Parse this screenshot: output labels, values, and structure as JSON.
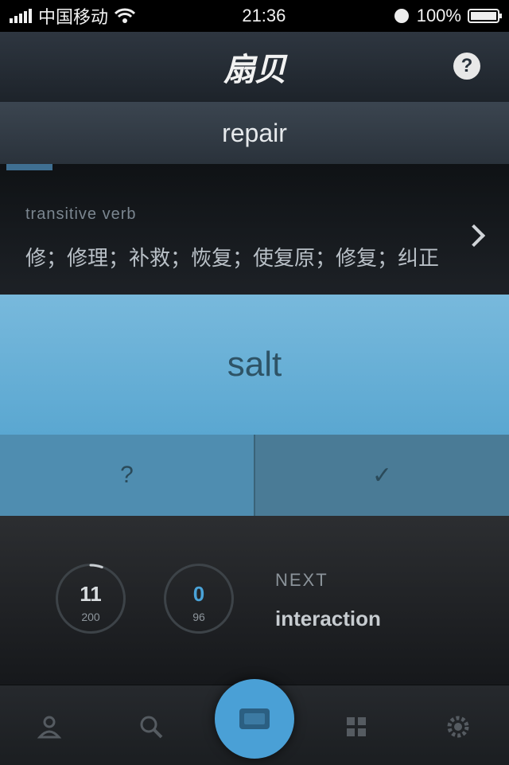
{
  "status_bar": {
    "carrier": "中国移动",
    "time": "21:36",
    "battery": "100%"
  },
  "header": {
    "logo": "扇贝"
  },
  "word_bar": {
    "word": "repair"
  },
  "definition": {
    "part_of_speech": "transitive verb",
    "text": "修；修理；补救；恢复；使复原；修复；纠正"
  },
  "card": {
    "word": "salt"
  },
  "answers": {
    "unknown_label": "?",
    "known_label": "✓"
  },
  "progress": {
    "ring1": {
      "count": "11",
      "total": "200",
      "fraction": 0.055
    },
    "ring2": {
      "count": "0",
      "total": "96",
      "fraction": 0
    },
    "next_label": "NEXT",
    "next_word": "interaction"
  },
  "tabbar": {
    "items": [
      {
        "icon": "user-icon"
      },
      {
        "icon": "search-icon"
      },
      {
        "icon": "cards-icon"
      },
      {
        "icon": "grid-icon"
      },
      {
        "icon": "gear-icon"
      }
    ]
  },
  "colors": {
    "accent": "#4aa0d6",
    "card": "#6ab3da"
  }
}
